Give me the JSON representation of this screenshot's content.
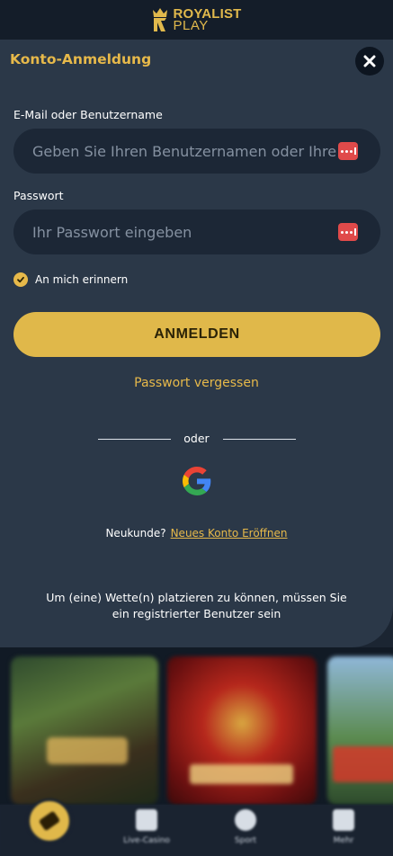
{
  "header": {
    "logo_line1": "ROYALIST",
    "logo_line2": "PLAY",
    "logo_icon": "crown-logo-icon"
  },
  "login_modal": {
    "title": "Konto-Anmeldung",
    "close_icon": "close-icon",
    "email_label": "E-Mail oder Benutzername",
    "email_placeholder": "Geben Sie Ihren Benutzernamen oder Ihre E-Mail ein",
    "email_value": "",
    "password_label": "Passwort",
    "password_placeholder": "Ihr Passwort eingeben",
    "password_value": "",
    "password_manager_icon": "password-manager-icon",
    "remember_label": "An mich erinnern",
    "remember_checked": true,
    "login_button": "ANMELDEN",
    "forgot_password": "Passwort vergessen",
    "divider_text": "oder",
    "google_icon": "google-icon",
    "signup_prompt": "Neukunde?",
    "signup_link": "Neues Konto Eröffnen",
    "notice": "Um (eine) Wette(n) platzieren zu können, müssen Sie ein registrierter Benutzer sein"
  },
  "bottom_nav": {
    "items": [
      {
        "label": "",
        "icon": "betslip-icon"
      },
      {
        "label": "Live-Casino",
        "icon": "live-casino-icon"
      },
      {
        "label": "Sport",
        "icon": "soccer-ball-icon"
      },
      {
        "label": "Mehr",
        "icon": "more-icon"
      }
    ]
  },
  "colors": {
    "accent": "#e0b84a",
    "modal_bg": "#2b3848",
    "page_bg": "#1b2532",
    "input_bg": "#1c2736"
  }
}
